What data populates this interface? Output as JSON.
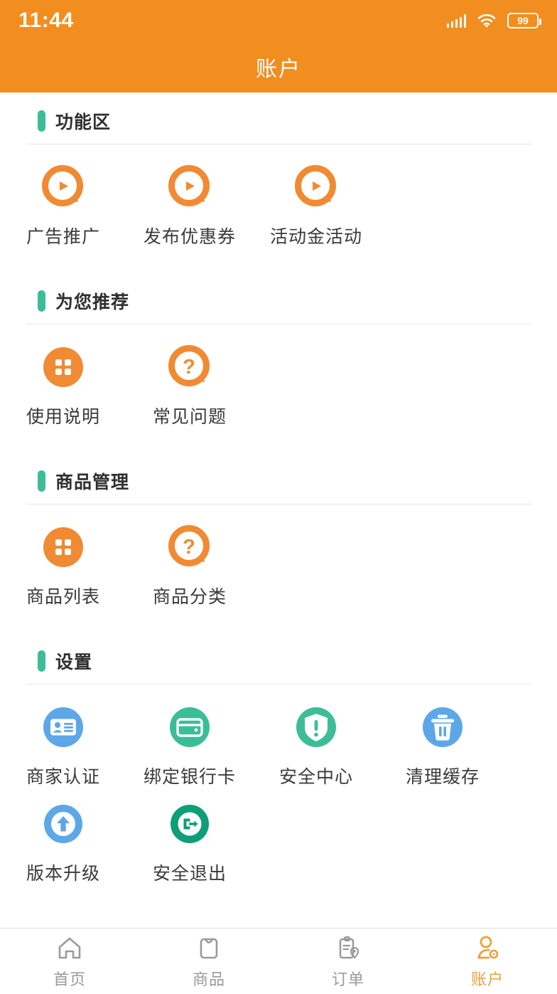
{
  "statusbar": {
    "time": "11:44",
    "battery_level": "99",
    "signal_icon": "signal-bars-icon",
    "wifi_icon": "wifi-icon",
    "battery_icon": "battery-icon"
  },
  "header": {
    "title": "账户",
    "background_color": "#F28E20"
  },
  "theme": {
    "accent_orange": "#F08A33",
    "accent_green": "#3CBD98",
    "accent_blue": "#5DA7E8",
    "accent_teal": "#0E9F78",
    "tab_active": "#E9A13B",
    "tab_inactive": "#9a9a9a"
  },
  "sections": [
    {
      "title": "功能区",
      "items": [
        {
          "label": "广告推广",
          "icon": "play-bubble-icon",
          "icon_style": "ring-play"
        },
        {
          "label": "发布优惠券",
          "icon": "play-bubble-icon",
          "icon_style": "ring-play"
        },
        {
          "label": "活动金活动",
          "icon": "play-bubble-icon",
          "icon_style": "ring-play"
        }
      ]
    },
    {
      "title": "为您推荐",
      "items": [
        {
          "label": "使用说明",
          "icon": "grid-squares-icon",
          "icon_style": "solid-grid"
        },
        {
          "label": "常见问题",
          "icon": "question-bubble-icon",
          "icon_style": "ring-question"
        }
      ]
    },
    {
      "title": "商品管理",
      "items": [
        {
          "label": "商品列表",
          "icon": "grid-squares-icon",
          "icon_style": "solid-grid"
        },
        {
          "label": "商品分类",
          "icon": "question-bubble-icon",
          "icon_style": "ring-question"
        }
      ]
    },
    {
      "title": "设置",
      "items": [
        {
          "label": "商家认证",
          "icon": "id-card-icon",
          "icon_style": "blue-idcard"
        },
        {
          "label": "绑定银行卡",
          "icon": "wallet-icon",
          "icon_style": "green-wallet"
        },
        {
          "label": "安全中心",
          "icon": "shield-alert-icon",
          "icon_style": "green-shield"
        },
        {
          "label": "清理缓存",
          "icon": "trash-icon",
          "icon_style": "blue-trash"
        },
        {
          "label": "版本升级",
          "icon": "arrow-up-circle-icon",
          "icon_style": "blue-upgrade"
        },
        {
          "label": "安全退出",
          "icon": "logout-icon",
          "icon_style": "teal-logout"
        }
      ]
    }
  ],
  "tabbar": {
    "items": [
      {
        "label": "首页",
        "icon": "home-icon",
        "active": false
      },
      {
        "label": "商品",
        "icon": "shopping-bag-icon",
        "active": false
      },
      {
        "label": "订单",
        "icon": "order-clipboard-icon",
        "active": false
      },
      {
        "label": "账户",
        "icon": "account-person-icon",
        "active": true
      }
    ]
  }
}
